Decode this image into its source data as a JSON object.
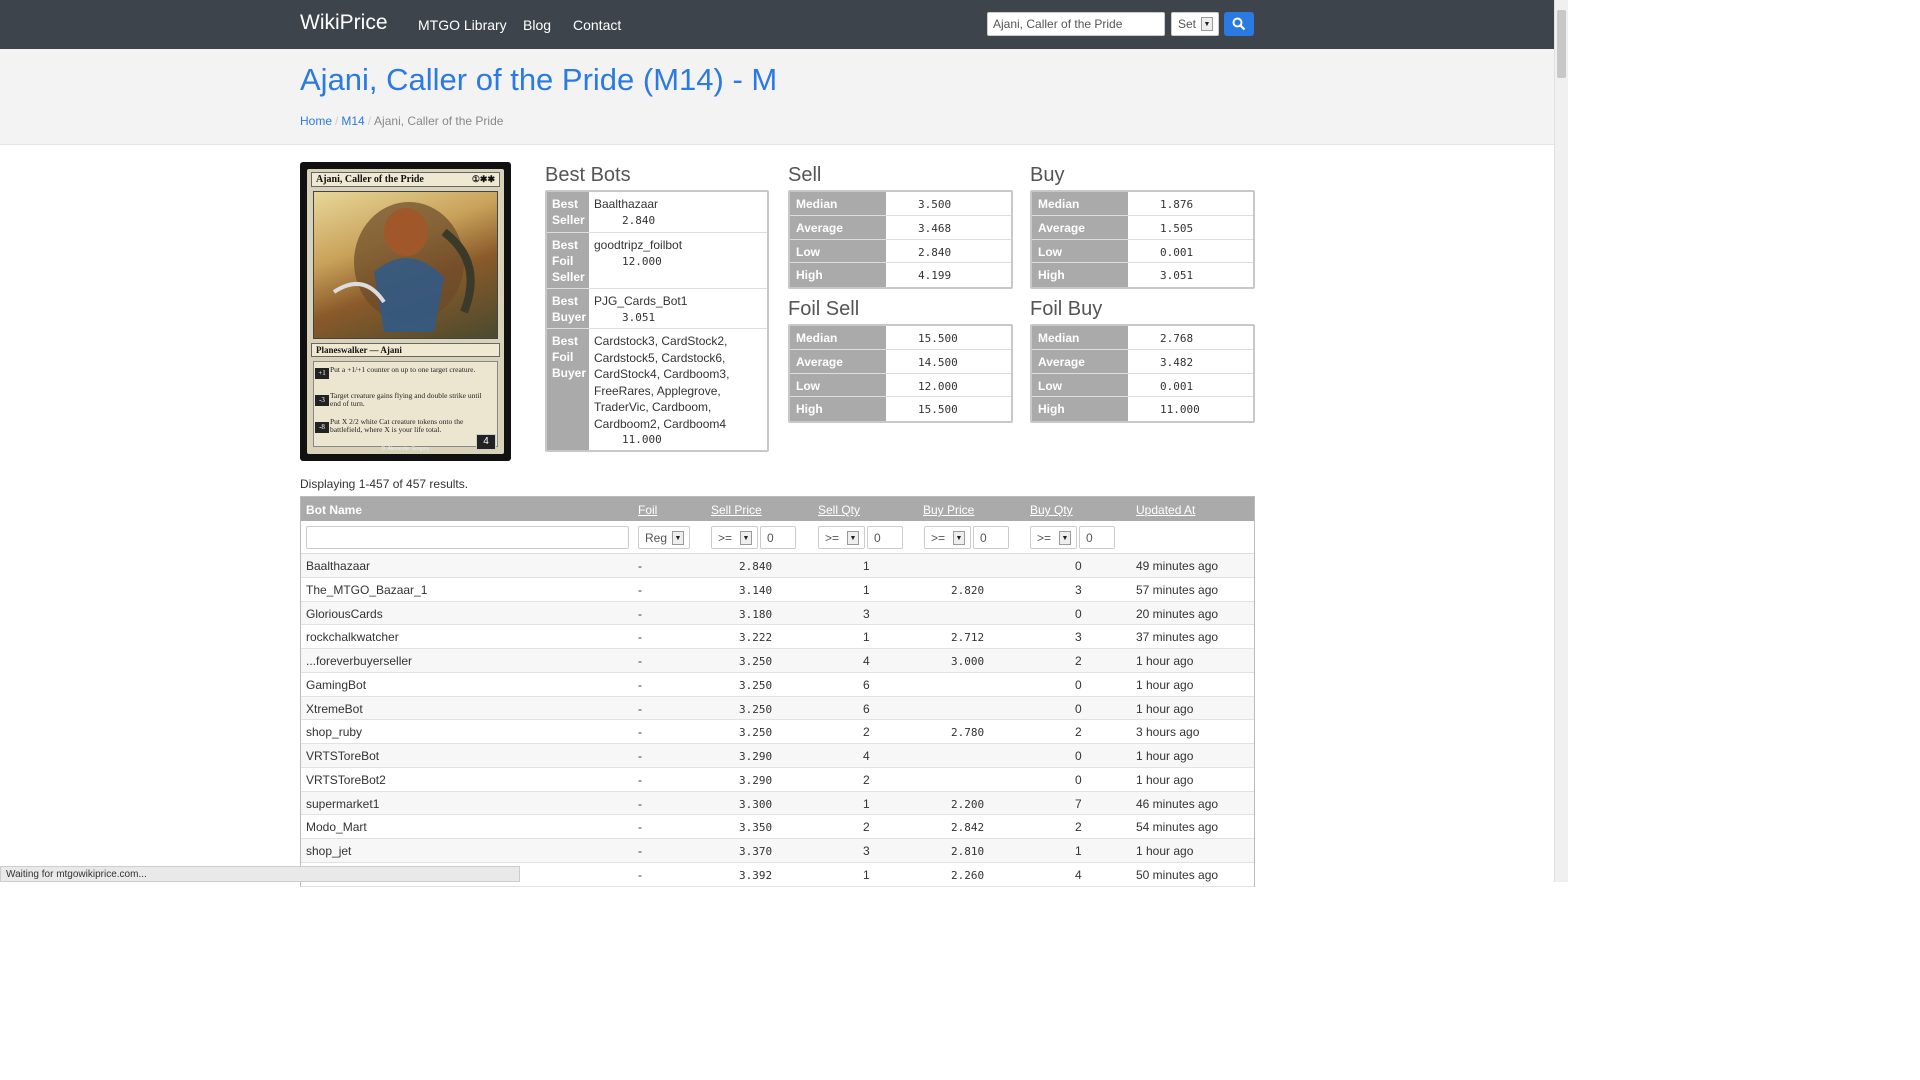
{
  "nav": {
    "brand": "WikiPrice",
    "links": [
      "MTGO Library",
      "Blog",
      "Contact"
    ],
    "search_value": "Ajani, Caller of the Pride",
    "search_select": "Set"
  },
  "title": "Ajani, Caller of the Pride (M14) - M",
  "breadcrumb": [
    "Home",
    "M14",
    "Ajani, Caller of the Pride"
  ],
  "card": {
    "name": "Ajani, Caller of the Pride",
    "type": "Planeswalker — Ajani",
    "abilities": [
      {
        "cost": "+1",
        "text": "Put a +1/+1 counter on up to one target creature."
      },
      {
        "cost": "-3",
        "text": "Target creature gains flying and double strike until end of turn."
      },
      {
        "cost": "-8",
        "text": "Put X 2/2 white Cat creature tokens onto the battlefield, where X is your life total."
      }
    ],
    "loyalty": "4",
    "artist": "D. Alexander Gregory"
  },
  "best_bots": {
    "title": "Best Bots",
    "rows": [
      {
        "label": "Best Seller",
        "value": "Baalthazaar",
        "price": "2.840"
      },
      {
        "label": "Best Foil Seller",
        "value": "goodtripz_foilbot",
        "price": "12.000"
      },
      {
        "label": "Best Buyer",
        "value": "PJG_Cards_Bot1",
        "price": "3.051"
      },
      {
        "label": "Best Foil Buyer",
        "value": "Cardstock3, CardStock2, Cardstock5, Cardstock6, CardStock4, Cardboom3, FreeRares, Applegrove, TraderVic, Cardboom, Cardboom2, Cardboom4",
        "price": "11.000"
      }
    ]
  },
  "stats": {
    "sell": {
      "title": "Sell",
      "rows": [
        [
          "Median",
          "3.500"
        ],
        [
          "Average",
          "3.468"
        ],
        [
          "Low",
          "2.840"
        ],
        [
          "High",
          "4.199"
        ]
      ]
    },
    "buy": {
      "title": "Buy",
      "rows": [
        [
          "Median",
          "1.876"
        ],
        [
          "Average",
          "1.505"
        ],
        [
          "Low",
          "0.001"
        ],
        [
          "High",
          "3.051"
        ]
      ]
    },
    "foil_sell": {
      "title": "Foil Sell",
      "rows": [
        [
          "Median",
          "15.500"
        ],
        [
          "Average",
          "14.500"
        ],
        [
          "Low",
          "12.000"
        ],
        [
          "High",
          "15.500"
        ]
      ]
    },
    "foil_buy": {
      "title": "Foil Buy",
      "rows": [
        [
          "Median",
          "2.768"
        ],
        [
          "Average",
          "3.482"
        ],
        [
          "Low",
          "0.001"
        ],
        [
          "High",
          "11.000"
        ]
      ]
    }
  },
  "results": "Displaying 1-457 of 457 results.",
  "table": {
    "headers": [
      "Bot Name",
      "Foil",
      "Sell Price",
      "Sell Qty",
      "Buy Price",
      "Buy Qty",
      "Updated At"
    ],
    "filters": {
      "foil": "Reg",
      "op": ">=",
      "num": "0"
    },
    "rows": [
      [
        "Baalthazaar",
        "-",
        "2.840",
        "1",
        "",
        "0",
        "49 minutes ago"
      ],
      [
        "The_MTGO_Bazaar_1",
        "-",
        "3.140",
        "1",
        "2.820",
        "3",
        "57 minutes ago"
      ],
      [
        "GloriousCards",
        "-",
        "3.180",
        "3",
        "",
        "0",
        "20 minutes ago"
      ],
      [
        "rockchalkwatcher",
        "-",
        "3.222",
        "1",
        "2.712",
        "3",
        "37 minutes ago"
      ],
      [
        "...foreverbuyerseller",
        "-",
        "3.250",
        "4",
        "3.000",
        "2",
        "1 hour ago"
      ],
      [
        "GamingBot",
        "-",
        "3.250",
        "6",
        "",
        "0",
        "1 hour ago"
      ],
      [
        "XtremeBot",
        "-",
        "3.250",
        "6",
        "",
        "0",
        "1 hour ago"
      ],
      [
        "shop_ruby",
        "-",
        "3.250",
        "2",
        "2.780",
        "2",
        "3 hours ago"
      ],
      [
        "VRTSToreBot",
        "-",
        "3.290",
        "4",
        "",
        "0",
        "1 hour ago"
      ],
      [
        "VRTSToreBot2",
        "-",
        "3.290",
        "2",
        "",
        "0",
        "1 hour ago"
      ],
      [
        "supermarket1",
        "-",
        "3.300",
        "1",
        "2.200",
        "7",
        "46 minutes ago"
      ],
      [
        "Modo_Mart",
        "-",
        "3.350",
        "2",
        "2.842",
        "2",
        "54 minutes ago"
      ],
      [
        "shop_jet",
        "-",
        "3.370",
        "3",
        "2.810",
        "1",
        "1 hour ago"
      ],
      [
        "",
        "-",
        "3.392",
        "1",
        "2.260",
        "4",
        "50 minutes ago"
      ]
    ]
  },
  "status_text": "Waiting for mtgowikiprice.com..."
}
